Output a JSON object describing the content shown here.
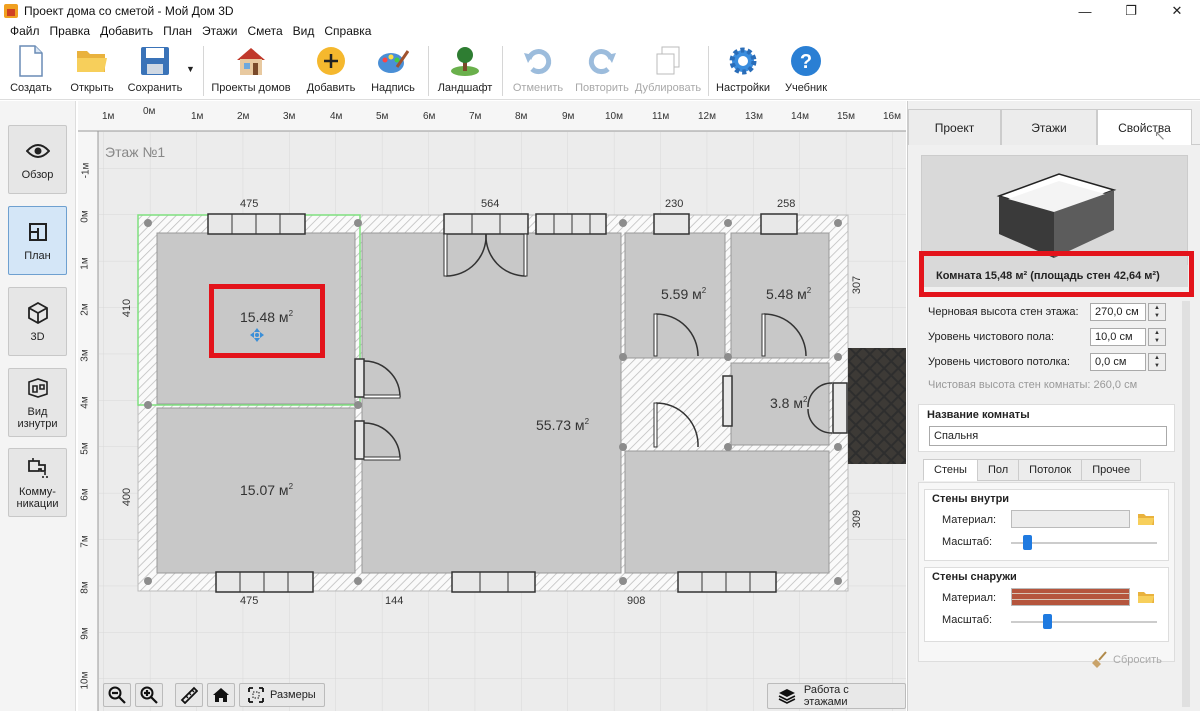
{
  "window": {
    "title": "Проект дома со сметой - Мой Дом 3D",
    "minimize": "—",
    "maximize": "❐",
    "close": "✕"
  },
  "menu": [
    "Файл",
    "Правка",
    "Добавить",
    "План",
    "Этажи",
    "Смета",
    "Вид",
    "Справка"
  ],
  "toolbar": {
    "create": "Создать",
    "open": "Открыть",
    "save": "Сохранить",
    "projects": "Проекты домов",
    "add": "Добавить",
    "label": "Надпись",
    "landscape": "Ландшафт",
    "undo": "Отменить",
    "redo": "Повторить",
    "duplicate": "Дублировать",
    "settings": "Настройки",
    "tutorial": "Учебник"
  },
  "left_panel": {
    "overview": "Обзор",
    "plan": "План",
    "view3d": "3D",
    "inside_line1": "Вид",
    "inside_line2": "изнутри",
    "utilities_line1": "Комму-",
    "utilities_line2": "никации"
  },
  "canvas": {
    "floor_label": "Этаж №1",
    "ruler_h": [
      "1м",
      "0м",
      "1м",
      "2м",
      "3м",
      "4м",
      "5м",
      "6м",
      "7м",
      "8м",
      "9м",
      "10м",
      "11м",
      "12м",
      "13м",
      "14м",
      "15м",
      "16м"
    ],
    "ruler_v": [
      "-1м",
      "0м",
      "1м",
      "2м",
      "3м",
      "4м",
      "5м",
      "6м",
      "7м",
      "8м",
      "9м",
      "10м"
    ],
    "rooms": {
      "r1": "15.48 м",
      "r2": "15.07 м",
      "r3": "55.73 м",
      "r4": "5.59 м",
      "r5": "5.48 м",
      "r6": "3.8 м",
      "sup": "2"
    },
    "dims": {
      "top1": "475",
      "top2": "564",
      "top3": "230",
      "top4": "258",
      "bottom1": "475",
      "bottom2": "144",
      "bottom3": "908",
      "left1": "410",
      "left2": "400",
      "right1": "307",
      "right2": "309"
    },
    "tools": {
      "dimensions": "Размеры",
      "floors": "Работа с этажами"
    }
  },
  "right_panel": {
    "tabs": [
      "Проект",
      "Этажи",
      "Свойства"
    ],
    "room_info": "Комната 15,48 м²  (площадь стен 42,64 м²)",
    "props": {
      "rough_height_label": "Черновая высота стен этажа:",
      "rough_height_value": "270,0 см",
      "floor_level_label": "Уровень чистового пола:",
      "floor_level_value": "10,0 см",
      "ceiling_level_label": "Уровень чистового потолка:",
      "ceiling_level_value": "0,0 см",
      "clean_height_note": "Чистовая высота стен комнаты: 260,0 см"
    },
    "room_name_title": "Название комнаты",
    "room_name_value": "Спальня",
    "sub_tabs": [
      "Стены",
      "Пол",
      "Потолок",
      "Прочее"
    ],
    "walls_inside_title": "Стены внутри",
    "walls_outside_title": "Стены снаружи",
    "material_label": "Материал:",
    "scale_label": "Масштаб:",
    "reset": "Сбросить"
  },
  "colors": {
    "highlight": "#e3131b",
    "slider": "#1f7ae0",
    "brick": "#b5553d"
  }
}
